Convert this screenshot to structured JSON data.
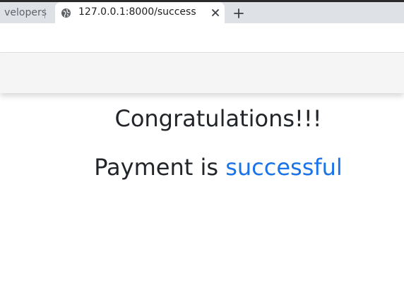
{
  "browser": {
    "tabs": [
      {
        "label": "velopers"
      },
      {
        "label": "127.0.0.1:8000/success"
      }
    ],
    "icons": {
      "site": "globe-icon",
      "close": "close-icon",
      "new_tab": "plus-icon"
    }
  },
  "page": {
    "heading": "Congratulations!!!",
    "message_prefix": "Payment is ",
    "message_highlight": "successful"
  },
  "colors": {
    "accent": "#1a73e8",
    "text": "#212529",
    "navbar": "#f5f5f5",
    "tabstrip": "#dee1e6"
  }
}
